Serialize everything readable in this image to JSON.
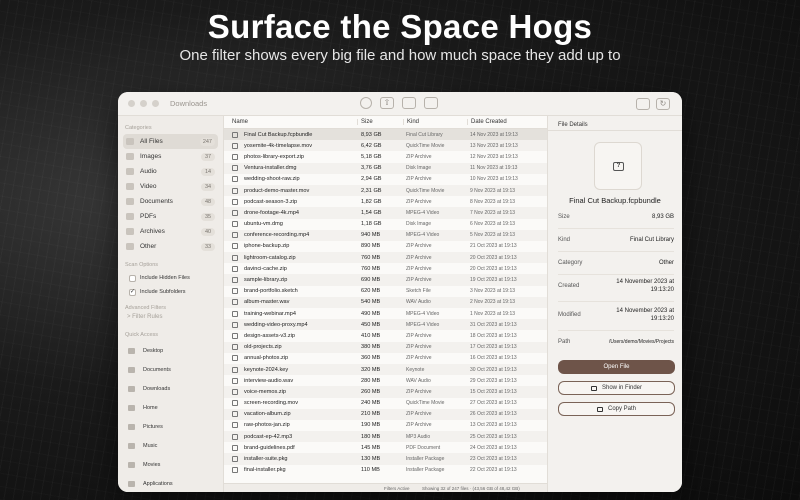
{
  "hero": {
    "title": "Surface the Space Hogs",
    "subtitle": "One filter shows every big file and how much space they add up to"
  },
  "window": {
    "title": "Downloads"
  },
  "sidebar": {
    "categories_header": "Categories",
    "categories": [
      {
        "label": "All Files",
        "count": "247",
        "icon": "all-files-icon"
      },
      {
        "label": "Images",
        "count": "37",
        "icon": "images-icon"
      },
      {
        "label": "Audio",
        "count": "14",
        "icon": "audio-icon"
      },
      {
        "label": "Video",
        "count": "34",
        "icon": "video-icon"
      },
      {
        "label": "Documents",
        "count": "48",
        "icon": "documents-icon"
      },
      {
        "label": "PDFs",
        "count": "35",
        "icon": "pdf-icon"
      },
      {
        "label": "Archives",
        "count": "40",
        "icon": "archive-icon"
      },
      {
        "label": "Other",
        "count": "33",
        "icon": "other-icon"
      }
    ],
    "scan_options_header": "Scan Options",
    "include_hidden": "Include Hidden Files",
    "include_subfolders": "Include Subfolders",
    "advanced_header": "Advanced Filters",
    "filter_rules": "> Filter Rules",
    "quick_access_header": "Quick Access",
    "quick_access": [
      "Desktop",
      "Documents",
      "Downloads",
      "Home",
      "Pictures",
      "Music",
      "Movies",
      "Applications"
    ]
  },
  "list": {
    "columns": {
      "name": "Name",
      "size": "Size",
      "kind": "Kind",
      "date": "Date Created"
    },
    "rows": [
      {
        "name": "Final Cut Backup.fcpbundle",
        "size": "8,93 GB",
        "kind": "Final Cut Library",
        "date": "14 Nov 2023 at 19:13"
      },
      {
        "name": "yosemite-4k-timelapse.mov",
        "size": "6,42 GB",
        "kind": "QuickTime Movie",
        "date": "13 Nov 2023 at 19:13"
      },
      {
        "name": "photos-library-export.zip",
        "size": "5,18 GB",
        "kind": "ZIP Archive",
        "date": "12 Nov 2023 at 19:13"
      },
      {
        "name": "Ventura-installer.dmg",
        "size": "3,76 GB",
        "kind": "Disk Image",
        "date": "11 Nov 2023 at 19:13"
      },
      {
        "name": "wedding-shoot-raw.zip",
        "size": "2,94 GB",
        "kind": "ZIP Archive",
        "date": "10 Nov 2023 at 19:13"
      },
      {
        "name": "product-demo-master.mov",
        "size": "2,31 GB",
        "kind": "QuickTime Movie",
        "date": "9 Nov 2023 at 19:13"
      },
      {
        "name": "podcast-season-3.zip",
        "size": "1,82 GB",
        "kind": "ZIP Archive",
        "date": "8 Nov 2023 at 19:13"
      },
      {
        "name": "drone-footage-4k.mp4",
        "size": "1,54 GB",
        "kind": "MPEG-4 Video",
        "date": "7 Nov 2023 at 19:13"
      },
      {
        "name": "ubuntu-vm.dmg",
        "size": "1,18 GB",
        "kind": "Disk Image",
        "date": "6 Nov 2023 at 19:13"
      },
      {
        "name": "conference-recording.mp4",
        "size": "940 MB",
        "kind": "MPEG-4 Video",
        "date": "5 Nov 2023 at 19:13"
      },
      {
        "name": "iphone-backup.zip",
        "size": "890 MB",
        "kind": "ZIP Archive",
        "date": "21 Oct 2023 at 19:13"
      },
      {
        "name": "lightroom-catalog.zip",
        "size": "760 MB",
        "kind": "ZIP Archive",
        "date": "20 Oct 2023 at 19:13"
      },
      {
        "name": "davinci-cache.zip",
        "size": "760 MB",
        "kind": "ZIP Archive",
        "date": "20 Oct 2023 at 19:13"
      },
      {
        "name": "sample-library.zip",
        "size": "690 MB",
        "kind": "ZIP Archive",
        "date": "19 Oct 2023 at 19:13"
      },
      {
        "name": "brand-portfolio.sketch",
        "size": "620 MB",
        "kind": "Sketch File",
        "date": "3 Nov 2023 at 19:13"
      },
      {
        "name": "album-master.wav",
        "size": "540 MB",
        "kind": "WAV Audio",
        "date": "2 Nov 2023 at 19:13"
      },
      {
        "name": "training-webinar.mp4",
        "size": "490 MB",
        "kind": "MPEG-4 Video",
        "date": "1 Nov 2023 at 19:13"
      },
      {
        "name": "wedding-video-proxy.mp4",
        "size": "450 MB",
        "kind": "MPEG-4 Video",
        "date": "31 Oct 2023 at 19:13"
      },
      {
        "name": "design-assets-v3.zip",
        "size": "410 MB",
        "kind": "ZIP Archive",
        "date": "18 Oct 2023 at 19:13"
      },
      {
        "name": "old-projects.zip",
        "size": "380 MB",
        "kind": "ZIP Archive",
        "date": "17 Oct 2023 at 19:13"
      },
      {
        "name": "annual-photos.zip",
        "size": "360 MB",
        "kind": "ZIP Archive",
        "date": "16 Oct 2023 at 19:13"
      },
      {
        "name": "keynote-2024.key",
        "size": "320 MB",
        "kind": "Keynote",
        "date": "30 Oct 2023 at 19:13"
      },
      {
        "name": "interview-audio.wav",
        "size": "280 MB",
        "kind": "WAV Audio",
        "date": "29 Oct 2023 at 19:13"
      },
      {
        "name": "voice-memos.zip",
        "size": "260 MB",
        "kind": "ZIP Archive",
        "date": "15 Oct 2023 at 19:13"
      },
      {
        "name": "screen-recording.mov",
        "size": "240 MB",
        "kind": "QuickTime Movie",
        "date": "27 Oct 2023 at 19:13"
      },
      {
        "name": "vacation-album.zip",
        "size": "210 MB",
        "kind": "ZIP Archive",
        "date": "26 Oct 2023 at 19:13"
      },
      {
        "name": "raw-photos-jan.zip",
        "size": "190 MB",
        "kind": "ZIP Archive",
        "date": "13 Oct 2023 at 19:13"
      },
      {
        "name": "podcast-ep-42.mp3",
        "size": "180 MB",
        "kind": "MP3 Audio",
        "date": "25 Oct 2023 at 19:13"
      },
      {
        "name": "brand-guidelines.pdf",
        "size": "145 MB",
        "kind": "PDF Document",
        "date": "24 Oct 2023 at 19:13"
      },
      {
        "name": "installer-suite.pkg",
        "size": "130 MB",
        "kind": "Installer Package",
        "date": "23 Oct 2023 at 19:13"
      },
      {
        "name": "final-installer.pkg",
        "size": "110 MB",
        "kind": "Installer Package",
        "date": "22 Oct 2023 at 19:13"
      }
    ],
    "status_filter": "Filters Active",
    "status_count": "Showing 32 of 247 files · (43,56 GB of 48,42 GB)"
  },
  "details": {
    "header": "File Details",
    "name": "Final Cut Backup.fcpbundle",
    "size_label": "Size",
    "size": "8,93 GB",
    "kind_label": "Kind",
    "kind": "Final Cut Library",
    "category_label": "Category",
    "category": "Other",
    "created_label": "Created",
    "created_1": "14 November 2023 at",
    "created_2": "19:13:20",
    "modified_label": "Modified",
    "modified_1": "14 November 2023 at",
    "modified_2": "19:13:20",
    "path_label": "Path",
    "path": "/Users/demo/Movies/Projects",
    "open_file": "Open File",
    "show_in_finder": "Show in Finder",
    "copy_path": "Copy Path"
  }
}
